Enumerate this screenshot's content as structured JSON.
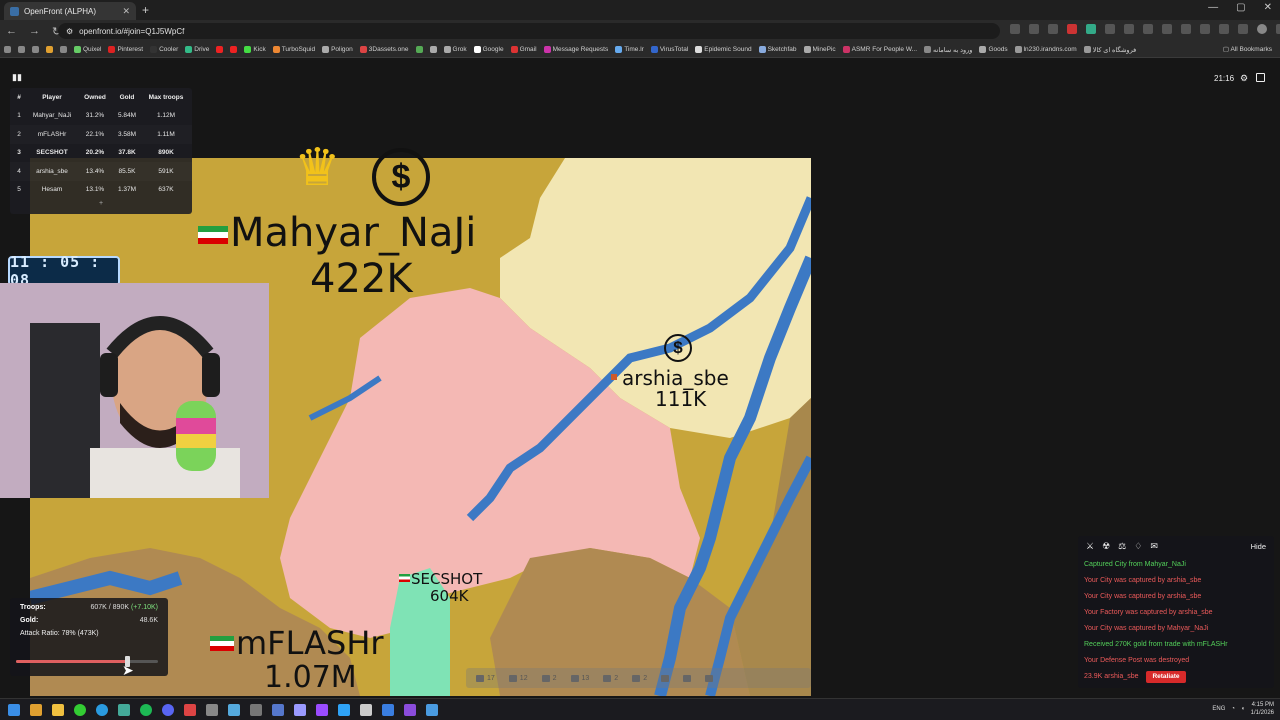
{
  "browser": {
    "tab_title": "OpenFront (ALPHA)",
    "url": "openfront.io/#join=Q1J5WpCf",
    "bookmarks": [
      "Quixel",
      "Pinterest",
      "Cooler",
      "Drive",
      "Kick",
      "TurboSquid",
      "Poligon",
      "3Dassets.one",
      "Grok",
      "Google",
      "Gmail",
      "Message Requests",
      "Time.lr",
      "VirusTotal",
      "Epidemic Sound",
      "Sketchfab",
      "MinePic",
      "ASMR For People W...",
      "ورود به سامانه",
      "Goods",
      "ln230.irandns.com",
      "فروشگاه ای کالا"
    ],
    "all_bookmarks": "All Bookmarks"
  },
  "game": {
    "time": "21:16",
    "leaderboard": {
      "headers": [
        "#",
        "Player",
        "Owned",
        "Gold",
        "Max troops"
      ],
      "rows": [
        {
          "rank": "1",
          "player": "Mahyar_NaJi",
          "owned": "31.2%",
          "gold": "5.84M",
          "max_troops": "1.12M",
          "bold": false
        },
        {
          "rank": "2",
          "player": "mFLASHr",
          "owned": "22.1%",
          "gold": "3.58M",
          "max_troops": "1.11M",
          "bold": false
        },
        {
          "rank": "3",
          "player": "SECSHOT",
          "owned": "20.2%",
          "gold": "37.8K",
          "max_troops": "890K",
          "bold": true
        },
        {
          "rank": "4",
          "player": "arshia_sbe",
          "owned": "13.4%",
          "gold": "85.5K",
          "max_troops": "591K",
          "bold": false
        },
        {
          "rank": "5",
          "player": "Hesam",
          "owned": "13.1%",
          "gold": "1.37M",
          "max_troops": "637K",
          "bold": false
        }
      ],
      "more": "+"
    },
    "clock": "11 : 05 : 08",
    "map_labels": {
      "mahyar": {
        "name": "Mahyar_NaJi",
        "troops": "422K"
      },
      "arshia": {
        "name": "arshia_sbe",
        "troops": "111K"
      },
      "secshot": {
        "name": "SECSHOT",
        "troops": "604K"
      },
      "mflashr": {
        "name": "mFLASHr",
        "troops": "1.07M"
      }
    },
    "hud": {
      "troops_label": "Troops:",
      "troops_value": "607K / 890K",
      "troops_rate": "(+7.10K)",
      "gold_label": "Gold:",
      "gold_value": "48.6K",
      "attack_ratio": "Attack Ratio: 78% (473K)",
      "attack_ratio_fraction": 0.78
    },
    "buildbar": [
      "17",
      "12",
      "2",
      "13",
      "2",
      "2"
    ],
    "events": {
      "hide": "Hide",
      "lines": [
        {
          "text": "Captured City from Mahyar_NaJi",
          "color": "green"
        },
        {
          "text": "Your City was captured by arshia_sbe",
          "color": "red"
        },
        {
          "text": "Your City was captured by arshia_sbe",
          "color": "red"
        },
        {
          "text": "Your Factory was captured by arshia_sbe",
          "color": "red"
        },
        {
          "text": "Your City was captured by Mahyar_NaJi",
          "color": "red"
        },
        {
          "text": "Received 270K gold from trade with mFLASHr",
          "color": "green"
        },
        {
          "text": "Your Defense Post was destroyed",
          "color": "red"
        }
      ],
      "last_line": "23.9K arshia_sbe",
      "retaliate": "Retaliate"
    }
  },
  "taskbar": {
    "lang": "ENG",
    "time": "4:15 PM",
    "date": "1/1/2026"
  },
  "colors": {
    "mahyar_territory": "#c7a53a",
    "arshia_territory": "#f2e6b3",
    "secshot_territory": "#f4b8b4",
    "mflashr_territory": "#b08a52",
    "water": "#3c79c4",
    "retaliate": "#d72a2a"
  }
}
